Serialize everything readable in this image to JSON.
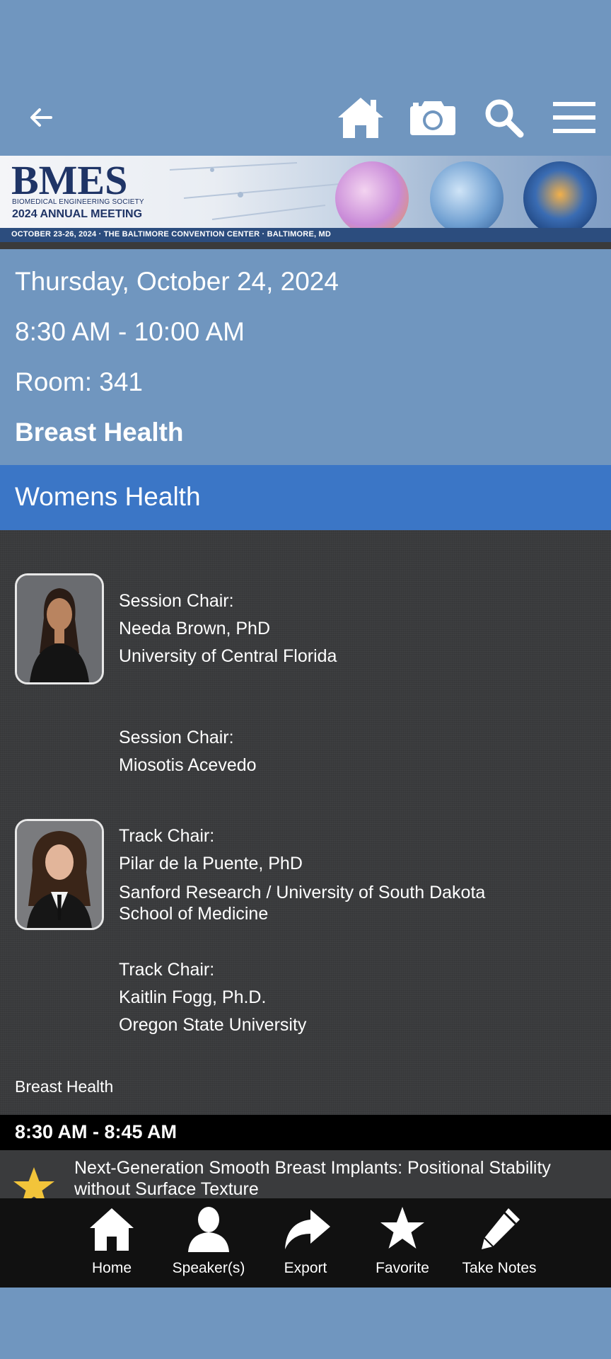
{
  "banner": {
    "logo_text": "BMES",
    "society": "BIOMEDICAL ENGINEERING SOCIETY",
    "meeting": "2024 ANNUAL MEETING",
    "strip": "OCTOBER 23-26, 2024 · THE BALTIMORE CONVENTION CENTER · BALTIMORE, MD"
  },
  "session": {
    "date": "Thursday, October 24, 2024",
    "time": "8:30 AM - 10:00 AM",
    "room": "Room: 341",
    "title": "Breast Health"
  },
  "track": {
    "name": "Womens Health"
  },
  "chairs": [
    {
      "role": "Session Chair:",
      "name": "Needa Brown, PhD",
      "affiliation": "University of Central Florida"
    },
    {
      "role": "Session Chair:",
      "name": "Miosotis Acevedo"
    },
    {
      "role": "Track Chair:",
      "name": "Pilar de la Puente, PhD",
      "affiliation_line1": "Sanford Research / University of South Dakota",
      "affiliation_line2": "School of Medicine"
    },
    {
      "role": "Track Chair:",
      "name": "Kaitlin Fogg, Ph.D.",
      "affiliation": "Oregon State University"
    }
  ],
  "session_label": "Breast Health",
  "presentations": [
    {
      "time": "8:30 AM - 8:45 AM",
      "title": "Next-Generation Smooth Breast Implants: Positional Stability without Surface Texture"
    }
  ],
  "bottom_nav": [
    {
      "label": "Home",
      "icon": "home-icon"
    },
    {
      "label": "Speaker(s)",
      "icon": "person-icon"
    },
    {
      "label": "Export",
      "icon": "share-arrow-icon"
    },
    {
      "label": "Favorite",
      "icon": "star-icon"
    },
    {
      "label": "Take Notes",
      "icon": "pencil-icon"
    }
  ],
  "colors": {
    "background": "#7096bf",
    "track_bar": "#3b76c6",
    "dark_panel": "#3a3b3d",
    "nav": "#111111",
    "favorite_star": "#f2c43a"
  }
}
